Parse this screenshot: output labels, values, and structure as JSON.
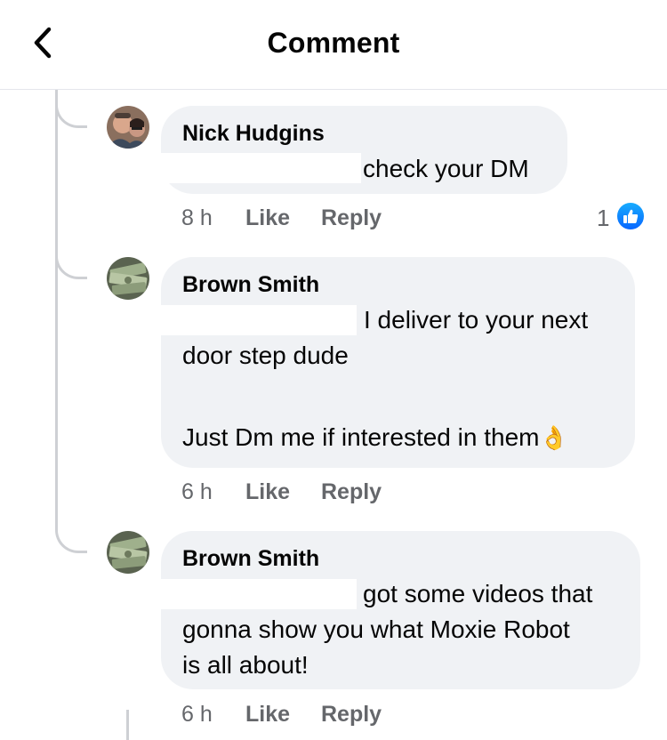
{
  "header": {
    "title": "Comment",
    "back_icon": "chevron-left-icon"
  },
  "comments": [
    {
      "author": "Nick Hudgins",
      "text": "check your DM",
      "time": "8 h",
      "like_label": "Like",
      "reply_label": "Reply",
      "reaction_count": "1",
      "reaction_icon": "thumbs-up-icon"
    },
    {
      "author": "Brown Smith",
      "text_line1": "I deliver to your next",
      "text_line2": "door step dude",
      "text_line3": "Just Dm me if interested in them",
      "emoji": "👌",
      "time": "6 h",
      "like_label": "Like",
      "reply_label": "Reply"
    },
    {
      "author": "Brown Smith",
      "text_line1": "got some videos that",
      "text_line2": "gonna show you what Moxie Robot",
      "text_line3": "is all about!",
      "time": "6 h",
      "like_label": "Like",
      "reply_label": "Reply"
    }
  ],
  "colors": {
    "bubble": "#f0f2f5",
    "meta_text": "#65676b",
    "like_blue": "#0866ff",
    "thread_line": "#ced0d4"
  }
}
